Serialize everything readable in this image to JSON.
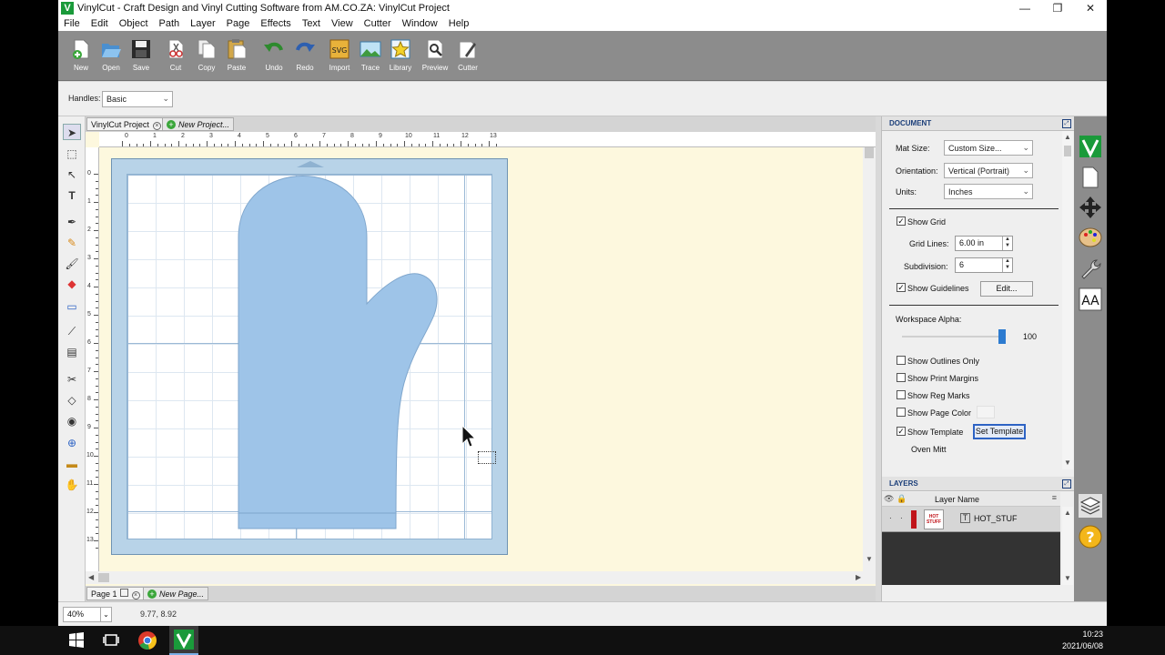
{
  "window": {
    "title": "VinylCut - Craft Design and Vinyl Cutting Software from AM.CO.ZA: VinylCut Project",
    "logo_letter": "V",
    "minimize": "—",
    "maximize": "❐",
    "close": "✕"
  },
  "menu": [
    "File",
    "Edit",
    "Object",
    "Path",
    "Layer",
    "Page",
    "Effects",
    "Text",
    "View",
    "Cutter",
    "Window",
    "Help"
  ],
  "toolbar": {
    "new": "New",
    "open": "Open",
    "save": "Save",
    "cut": "Cut",
    "copy": "Copy",
    "paste": "Paste",
    "undo": "Undo",
    "redo": "Redo",
    "import": "Import",
    "trace": "Trace",
    "library": "Library",
    "preview": "Preview",
    "cutter": "Cutter"
  },
  "options": {
    "handles_label": "Handles:",
    "handles_value": "Basic"
  },
  "tabs": {
    "project": "VinylCut Project",
    "new_project": "New Project..."
  },
  "pages": {
    "page1": "Page 1",
    "new_page": "New Page..."
  },
  "rulers": {
    "h": [
      "0",
      "1",
      "2",
      "3",
      "4",
      "5",
      "6",
      "7",
      "8",
      "9",
      "10",
      "11",
      "12",
      "13"
    ],
    "v": [
      "0",
      "1",
      "2",
      "3",
      "4",
      "5",
      "6",
      "7",
      "8",
      "9",
      "10",
      "11",
      "12",
      "13"
    ]
  },
  "document": {
    "header": "DOCUMENT",
    "mat_size_label": "Mat Size:",
    "mat_size_value": "Custom Size...",
    "orientation_label": "Orientation:",
    "orientation_value": "Vertical (Portrait)",
    "units_label": "Units:",
    "units_value": "Inches",
    "show_grid": "Show Grid",
    "grid_lines_label": "Grid Lines:",
    "grid_lines_value": "6.00 in",
    "subdivision_label": "Subdivision:",
    "subdivision_value": "6",
    "show_guidelines": "Show Guidelines",
    "edit_button": "Edit...",
    "workspace_alpha_label": "Workspace Alpha:",
    "workspace_alpha_value": "100",
    "workspace_alpha_fraction": 1.0,
    "show_outlines_only": "Show Outlines Only",
    "show_print_margins": "Show Print Margins",
    "show_reg_marks": "Show Reg Marks",
    "show_page_color": "Show Page Color",
    "show_template": "Show Template",
    "set_template_button": "Set Template",
    "template_name": "Oven Mitt",
    "check": "✓"
  },
  "layers": {
    "header": "LAYERS",
    "column_name": "Layer Name",
    "layer_name": "HOT_STUF",
    "thumb_text": "HOT STUFF",
    "layer_color": "#c0141a"
  },
  "status": {
    "zoom": "40%",
    "coords": "9.77, 8.92"
  },
  "taskbar": {
    "time": "10:23",
    "date": "2021/06/08"
  },
  "colors": {
    "mitt": "#9ec4e8",
    "mat": "#b8d3e8",
    "workspace": "#fdf8de",
    "toolbar": "#8c8c8c",
    "accent": "#2d63c4"
  }
}
